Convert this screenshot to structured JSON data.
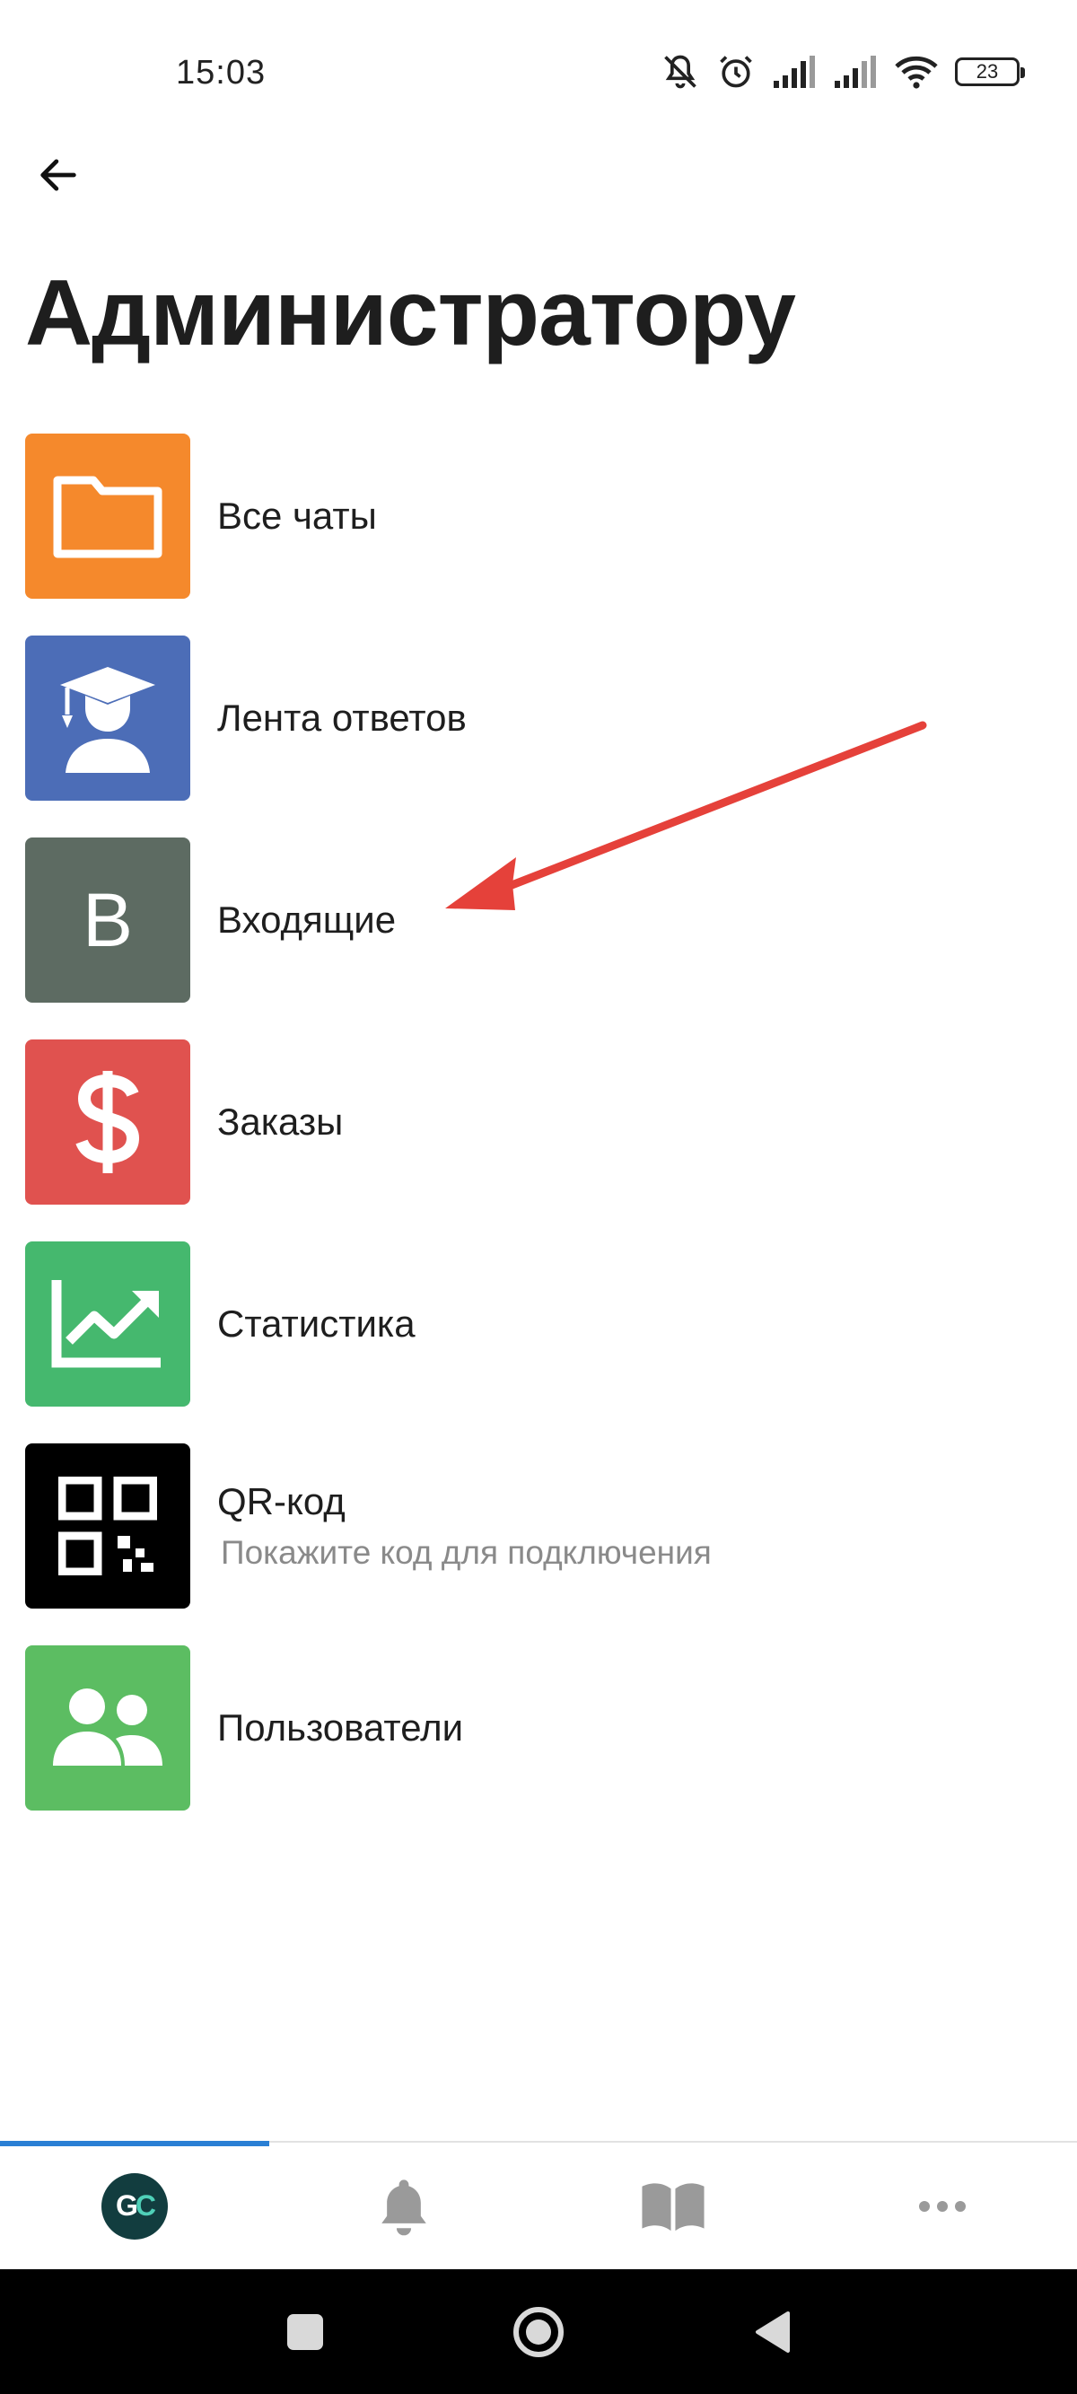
{
  "status_bar": {
    "time": "15:03",
    "battery_level": "23",
    "icons": [
      "muted-bell-icon",
      "alarm-icon",
      "signal-icon",
      "signal-icon",
      "wifi-icon",
      "battery-icon"
    ]
  },
  "header": {
    "back_icon": "arrow-left-icon",
    "title": "Администратору"
  },
  "menu": {
    "items": [
      {
        "label": "Все чаты",
        "icon": "folder-icon",
        "color": "#F5892C"
      },
      {
        "label": "Лента ответов",
        "icon": "graduate-icon",
        "color": "#4C6DB7"
      },
      {
        "label": "Входящие",
        "icon": "letter-icon",
        "glyph": "В",
        "color": "#5D6B62"
      },
      {
        "label": "Заказы",
        "icon": "dollar-icon",
        "color": "#E0524F"
      },
      {
        "label": "Статистика",
        "icon": "chart-trend-icon",
        "color": "#45B86E"
      },
      {
        "label": "QR-код",
        "sublabel": "Покажите код для подключения",
        "icon": "qr-code-icon",
        "color": "#000000"
      },
      {
        "label": "Пользователи",
        "icon": "users-icon",
        "color": "#5CBD62"
      }
    ]
  },
  "annotation": {
    "color": "#E5413A",
    "points_to": "Входящие"
  },
  "tab_bar": {
    "active_index": 0,
    "accent": "#2A7FD4",
    "tabs": [
      {
        "icon": "gc-logo-icon",
        "logo_g": "G",
        "logo_c": "C"
      },
      {
        "icon": "bell-icon"
      },
      {
        "icon": "book-icon"
      },
      {
        "icon": "more-dots-icon"
      }
    ]
  },
  "nav_bar": {
    "buttons": [
      "recent-apps-icon",
      "home-icon",
      "back-triangle-icon"
    ]
  }
}
